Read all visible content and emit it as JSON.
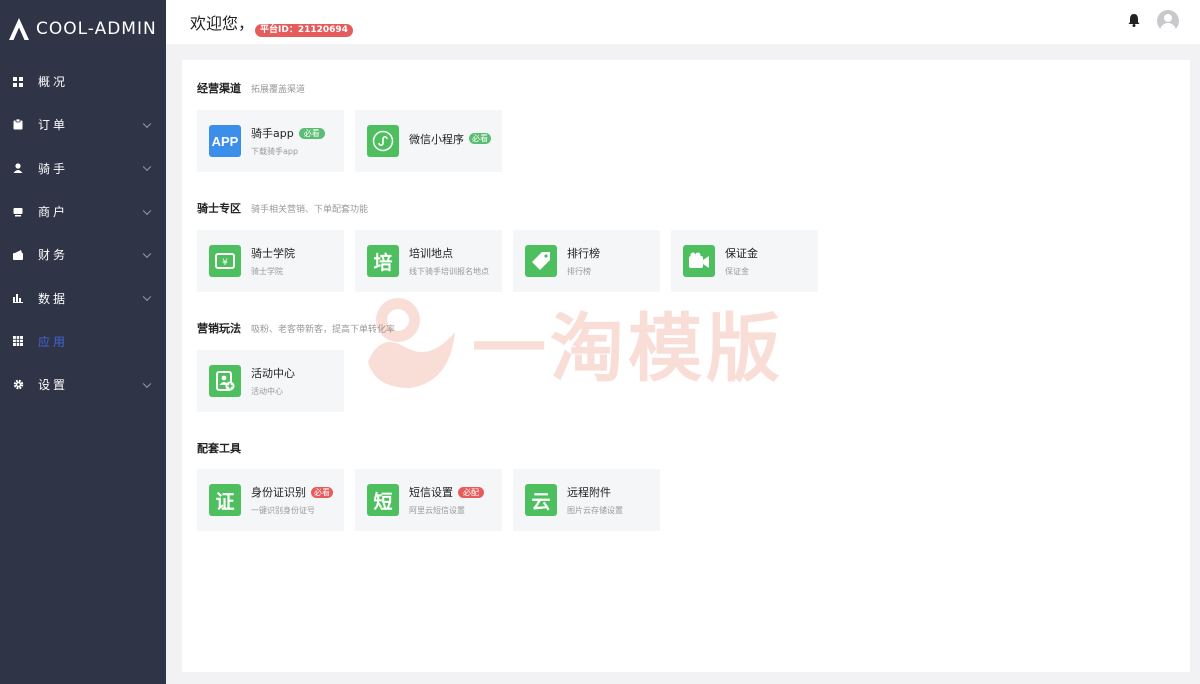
{
  "app": {
    "name": "COOL-ADMIN"
  },
  "sidebar": {
    "items": [
      {
        "label": "概况",
        "icon": "dashboard-icon"
      },
      {
        "label": "订单",
        "icon": "order-icon"
      },
      {
        "label": "骑手",
        "icon": "user-icon"
      },
      {
        "label": "商户",
        "icon": "shop-icon"
      },
      {
        "label": "财务",
        "icon": "wallet-icon"
      },
      {
        "label": "数据",
        "icon": "bar-chart-icon"
      },
      {
        "label": "应用",
        "icon": "grid-icon"
      },
      {
        "label": "设置",
        "icon": "gear-icon"
      }
    ],
    "active_index": 6,
    "active_color": "#4165d7"
  },
  "header": {
    "welcome": "欢迎您，",
    "platform_badge": "平台ID：21120694"
  },
  "sections": [
    {
      "title": "经营渠道",
      "desc": "拓展覆盖渠道",
      "cards": [
        {
          "title": "骑手app",
          "sub": "下载骑手app",
          "tag": "必看",
          "icon": "app-icon"
        },
        {
          "title": "微信小程序",
          "sub": "",
          "tag": "必看",
          "icon": "mini-program-icon"
        }
      ]
    },
    {
      "title": "骑士专区",
      "desc": "骑手相关营销、下单配套功能",
      "cards": [
        {
          "title": "骑士学院",
          "sub": "骑士学院",
          "icon": "academy-icon"
        },
        {
          "title": "培训地点",
          "sub": "线下骑手培训报名地点",
          "icon": "training-icon",
          "glyph": "培"
        },
        {
          "title": "排行榜",
          "sub": "排行榜",
          "icon": "ranking-tag-icon"
        },
        {
          "title": "保证金",
          "sub": "保证金",
          "icon": "deposit-icon"
        }
      ]
    },
    {
      "title": "营销玩法",
      "desc": "吸粉、老客带新客，提高下单转化率",
      "cards": [
        {
          "title": "活动中心",
          "sub": "活动中心",
          "icon": "activity-icon"
        }
      ]
    },
    {
      "title": "配套工具",
      "desc": "",
      "cards": [
        {
          "title": "身份证识别",
          "sub": "一键识别身份证号",
          "tag": "必看",
          "icon": "id-card-icon",
          "glyph": "证"
        },
        {
          "title": "短信设置",
          "sub": "阿里云短信设置",
          "tag": "必配",
          "icon": "sms-icon",
          "glyph": "短"
        },
        {
          "title": "远程附件",
          "sub": "图片云存储设置",
          "icon": "cloud-icon",
          "glyph": "云"
        }
      ]
    }
  ],
  "watermark": {
    "text": "一淘模版"
  },
  "colors": {
    "green": "#4dbf5e",
    "blue": "#3b8eea",
    "red": "#e65c5c",
    "sidebar": "#2f3447"
  }
}
